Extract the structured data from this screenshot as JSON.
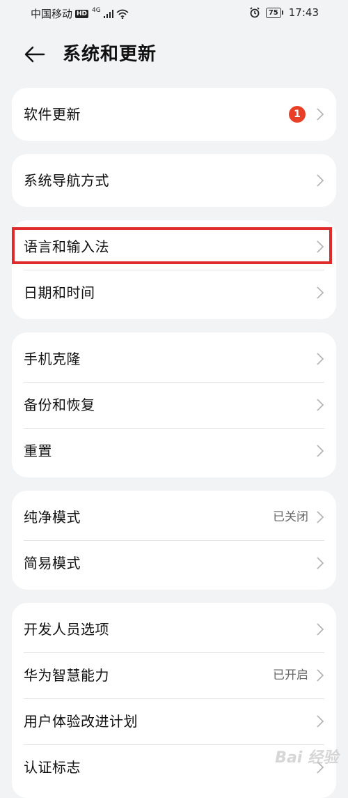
{
  "status_bar": {
    "carrier": "中国移动",
    "hd": "HD",
    "network": "4G",
    "battery": "75",
    "time": "17:43"
  },
  "header": {
    "title": "系统和更新"
  },
  "groups": [
    {
      "items": [
        {
          "label": "软件更新",
          "badge": "1"
        }
      ]
    },
    {
      "items": [
        {
          "label": "系统导航方式"
        }
      ]
    },
    {
      "items": [
        {
          "label": "语言和输入法",
          "highlighted": true
        },
        {
          "label": "日期和时间"
        }
      ]
    },
    {
      "items": [
        {
          "label": "手机克隆"
        },
        {
          "label": "备份和恢复"
        },
        {
          "label": "重置"
        }
      ]
    },
    {
      "items": [
        {
          "label": "纯净模式",
          "value": "已关闭"
        },
        {
          "label": "简易模式"
        }
      ]
    },
    {
      "items": [
        {
          "label": "开发人员选项"
        },
        {
          "label": "华为智慧能力",
          "value": "已开启"
        },
        {
          "label": "用户体验改进计划"
        },
        {
          "label": "认证标志"
        }
      ]
    }
  ],
  "watermark": "Bai 经验",
  "colors": {
    "background": "#f1f3f5",
    "card": "#ffffff",
    "badge": "#e84026",
    "highlight_border": "#e02b2b"
  }
}
